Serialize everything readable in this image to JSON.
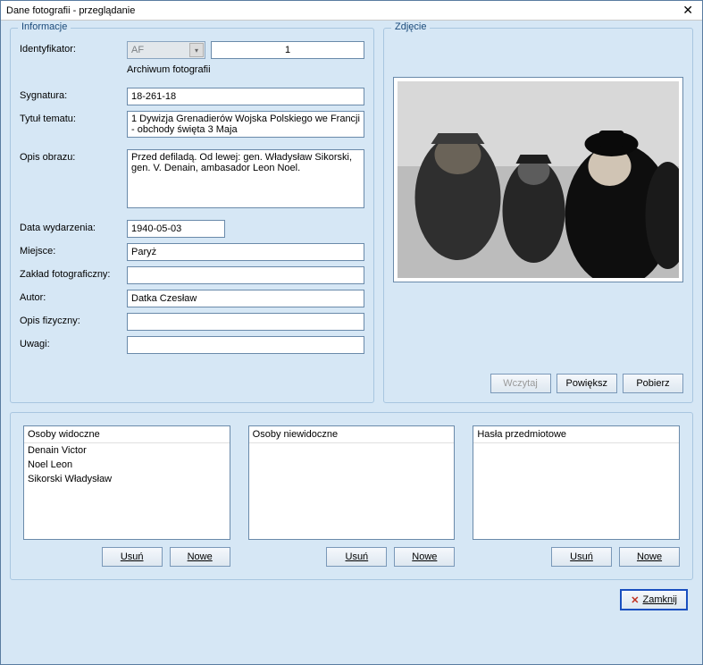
{
  "window": {
    "title": "Dane fotografii - przeglądanie"
  },
  "groups": {
    "info": "Informacje",
    "photo": "Zdjęcie"
  },
  "labels": {
    "identyfikator": "Identyfikator:",
    "archive_note": "Archiwum fotografii",
    "sygnatura": "Sygnatura:",
    "tytul": "Tytuł tematu:",
    "opis_obrazu": "Opis obrazu:",
    "data": "Data wydarzenia:",
    "miejsce": "Miejsce:",
    "zaklad": "Zakład fotograficzny:",
    "autor": "Autor:",
    "opis_fiz": "Opis fizyczny:",
    "uwagi": "Uwagi:"
  },
  "values": {
    "id_prefix": "AF",
    "id_num": "1",
    "sygnatura": "18-261-18",
    "tytul": "1 Dywizja Grenadierów Wojska Polskiego we Francji - obchody święta 3 Maja",
    "opis_obrazu": "Przed defiladą. Od lewej: gen. Władysław Sikorski, gen. V. Denain, ambasador Leon Noel.",
    "data": "1940-05-03",
    "miejsce": "Paryż",
    "zaklad": "",
    "autor": "Datka Czesław",
    "opis_fiz": "",
    "uwagi": ""
  },
  "photo_buttons": {
    "wczytaj": "Wczytaj",
    "powieksz": "Powiększ",
    "pobierz": "Pobierz"
  },
  "lists": {
    "visible": {
      "header": "Osoby widoczne",
      "items": [
        "Denain Victor",
        "Noel Leon",
        "Sikorski Władysław"
      ]
    },
    "invisible": {
      "header": "Osoby niewidoczne",
      "items": []
    },
    "subjects": {
      "header": "Hasła przedmiotowe",
      "items": []
    }
  },
  "list_buttons": {
    "usun": "Usuń",
    "nowe": "Nowe"
  },
  "footer": {
    "close": "Zamknij"
  }
}
